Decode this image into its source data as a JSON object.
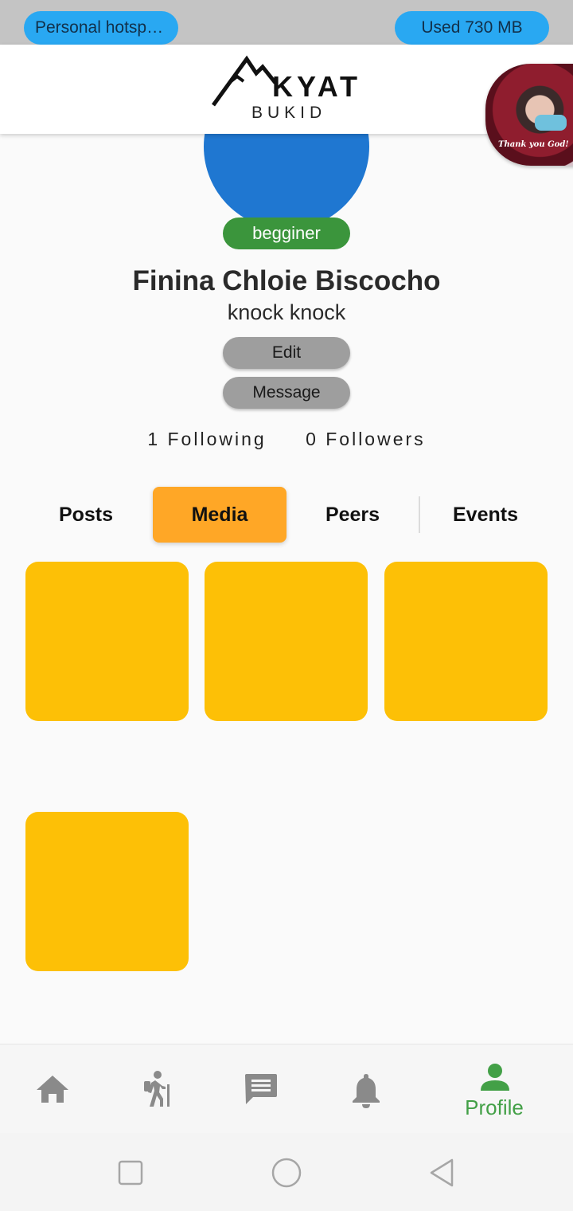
{
  "status_bar": {
    "hotspot_label": "Personal hotspot...",
    "data_usage": "Used  730 MB"
  },
  "header": {
    "logo_word": "KYAT",
    "logo_sub": "BUKID",
    "floating_caption": "Thank you God!"
  },
  "profile": {
    "level": "begginer",
    "name": "Finina Chloie Biscocho",
    "bio": "knock knock",
    "edit_label": "Edit",
    "message_label": "Message",
    "following": "1 Following",
    "followers": "0 Followers"
  },
  "tabs": [
    {
      "label": "Posts"
    },
    {
      "label": "Media",
      "active": true
    },
    {
      "label": "Peers"
    },
    {
      "label": "Events"
    }
  ],
  "media": {
    "tile_count": 4,
    "tile_color": "#fdc006"
  },
  "bottom_nav": {
    "items": [
      {
        "icon": "home-icon"
      },
      {
        "icon": "hiker-icon"
      },
      {
        "icon": "chat-icon"
      },
      {
        "icon": "bell-icon"
      },
      {
        "icon": "person-icon",
        "label": "Profile",
        "active": true
      }
    ]
  },
  "colors": {
    "accent_green": "#43a047",
    "tab_active": "#ffa726",
    "avatar_blue": "#1f77d1",
    "status_pill": "#29a8f2"
  }
}
